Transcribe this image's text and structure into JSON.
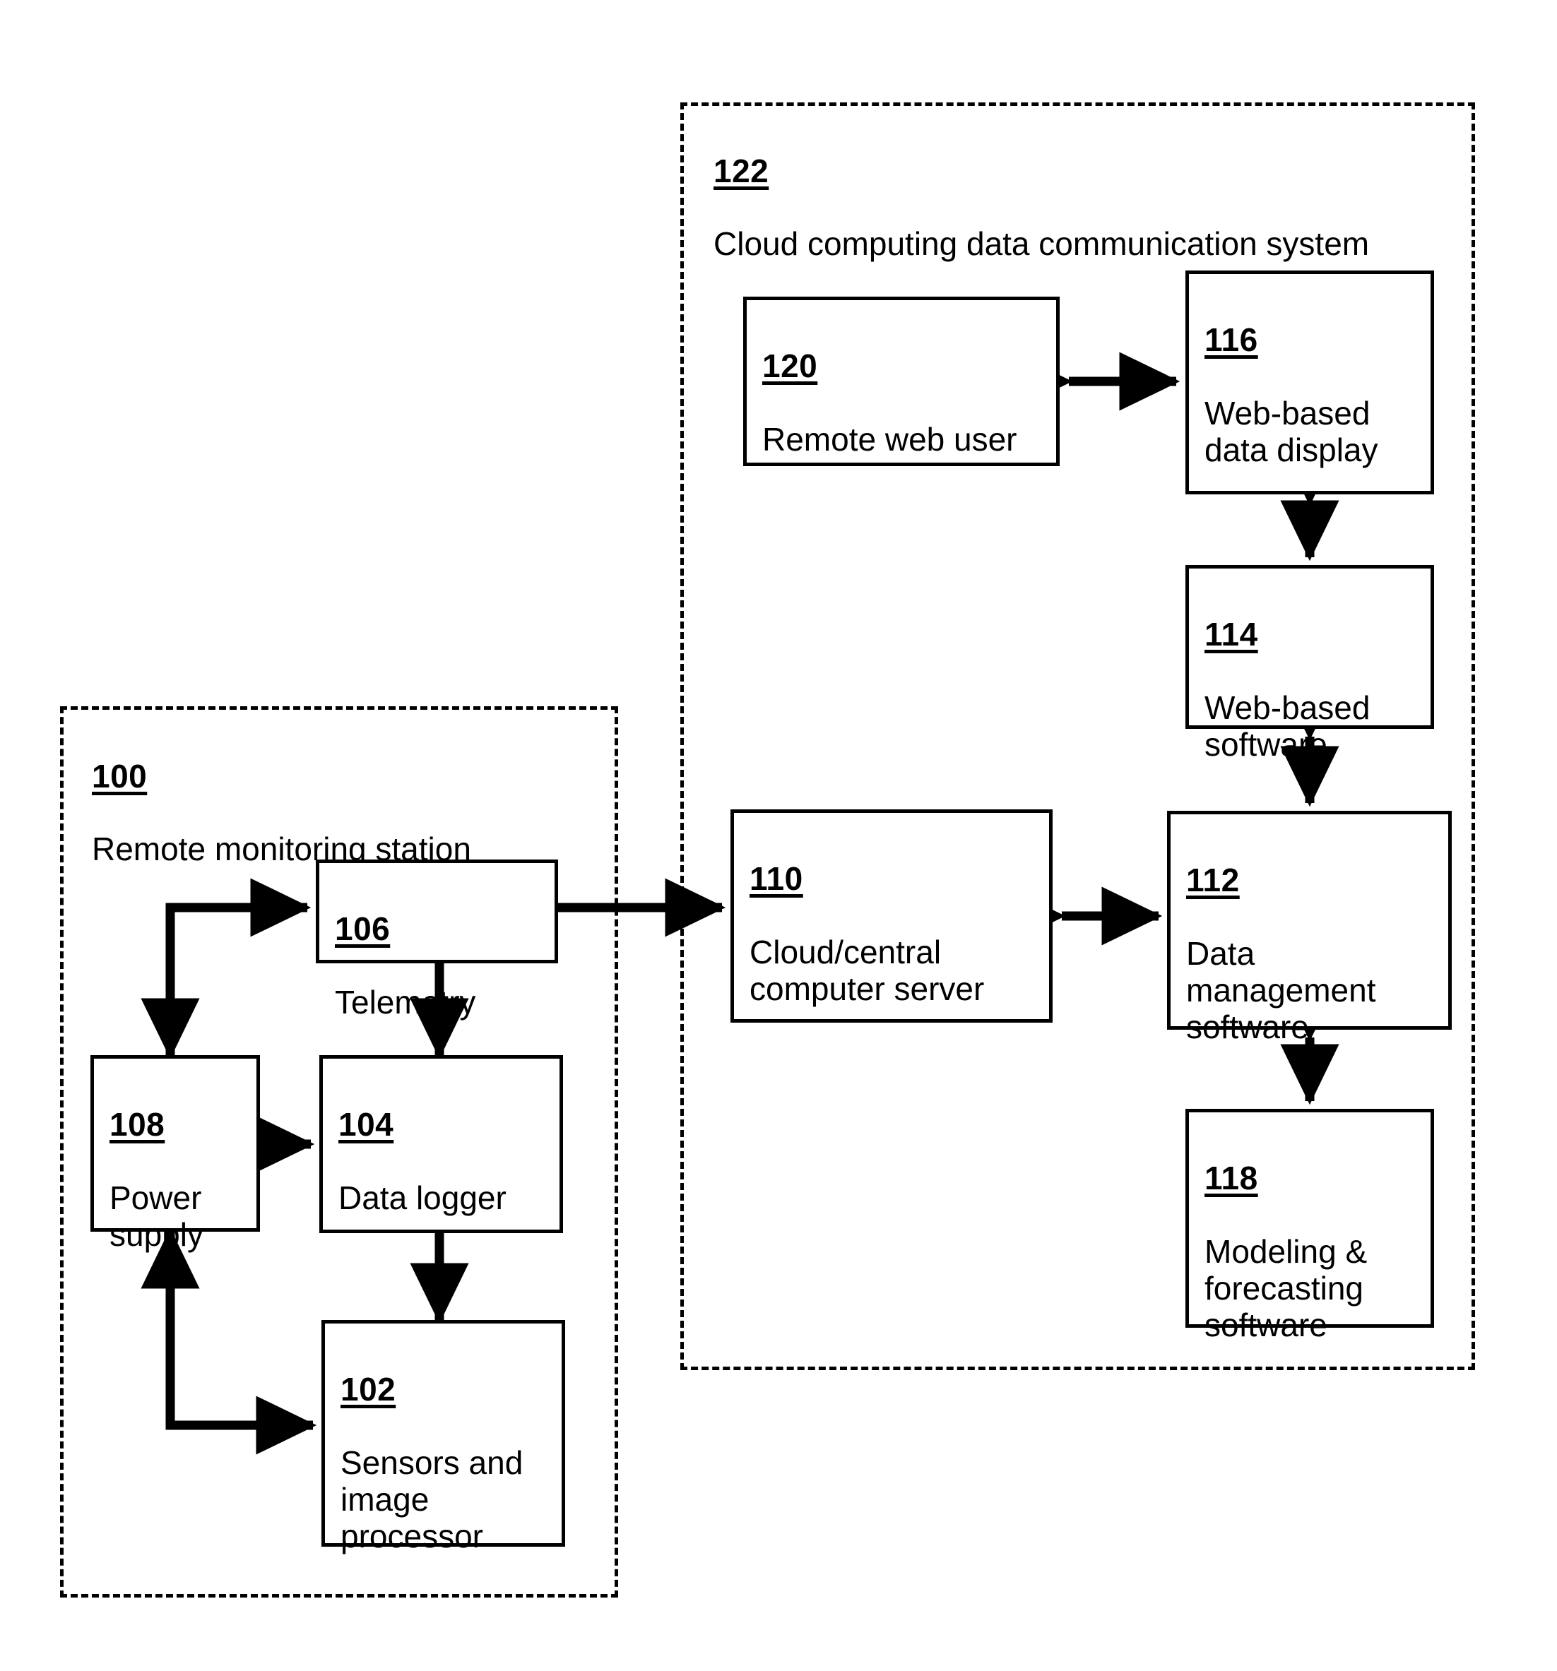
{
  "figure": {
    "background": "#ffffff",
    "line_color": "#000000"
  },
  "groups": [
    {
      "id": "group-122",
      "ref": "122",
      "label": "Cloud computing data communication system",
      "style": "dashed"
    },
    {
      "id": "group-100",
      "ref": "100",
      "label": "Remote monitoring station",
      "style": "dashed"
    }
  ],
  "nodes": [
    {
      "id": "node-120",
      "ref": "120",
      "label": "Remote web user"
    },
    {
      "id": "node-116",
      "ref": "116",
      "label": "Web-based data display"
    },
    {
      "id": "node-114",
      "ref": "114",
      "label": "Web-based software"
    },
    {
      "id": "node-110",
      "ref": "110",
      "label": "Cloud/central computer server"
    },
    {
      "id": "node-112",
      "ref": "112",
      "label": "Data management software"
    },
    {
      "id": "node-118",
      "ref": "118",
      "label": "Modeling & forecasting software"
    },
    {
      "id": "node-106",
      "ref": "106",
      "label": "Telemetry"
    },
    {
      "id": "node-108",
      "ref": "108",
      "label": "Power supply"
    },
    {
      "id": "node-104",
      "ref": "104",
      "label": "Data logger"
    },
    {
      "id": "node-102",
      "ref": "102",
      "label": "Sensors and image processor"
    }
  ],
  "connectors": [
    {
      "id": "arrow-120-116",
      "from": "120",
      "to": "116",
      "type": "double-arrow",
      "orientation": "horizontal"
    },
    {
      "id": "arrow-116-114",
      "from": "116",
      "to": "114",
      "type": "double-arrow",
      "orientation": "vertical"
    },
    {
      "id": "arrow-114-112",
      "from": "114",
      "to": "112",
      "type": "double-arrow",
      "orientation": "vertical"
    },
    {
      "id": "arrow-110-112",
      "from": "110",
      "to": "112",
      "type": "double-arrow",
      "orientation": "horizontal"
    },
    {
      "id": "arrow-112-118",
      "from": "112",
      "to": "118",
      "type": "double-arrow",
      "orientation": "vertical"
    },
    {
      "id": "arrow-106-110",
      "from": "106",
      "to": "110",
      "type": "double-arrow",
      "orientation": "horizontal"
    },
    {
      "id": "arrow-106-104",
      "from": "106",
      "to": "104",
      "type": "double-arrow",
      "orientation": "vertical"
    },
    {
      "id": "arrow-108-104",
      "from": "108",
      "to": "104",
      "type": "double-arrow",
      "orientation": "horizontal"
    },
    {
      "id": "arrow-104-102",
      "from": "104",
      "to": "102",
      "type": "double-arrow",
      "orientation": "vertical"
    },
    {
      "id": "arrow-106-108",
      "from": "106",
      "to": "108",
      "type": "single-arrow",
      "orientation": "elbow"
    },
    {
      "id": "arrow-102-108",
      "from": "102",
      "to": "108",
      "type": "single-arrow",
      "orientation": "elbow"
    }
  ]
}
